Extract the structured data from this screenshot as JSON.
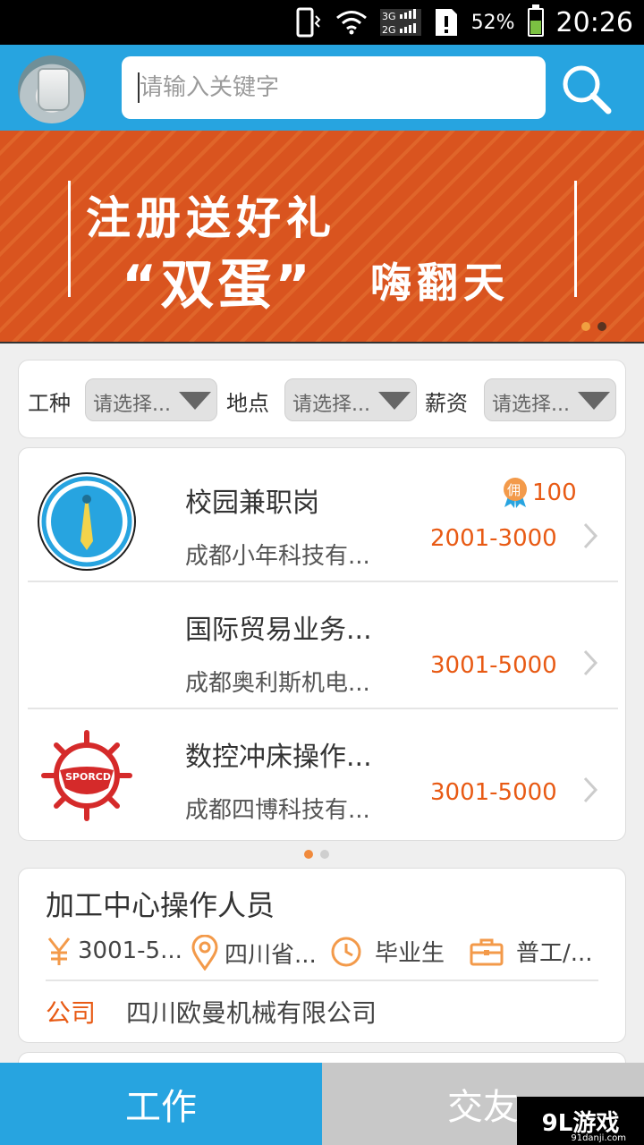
{
  "status_bar": {
    "battery": "52%",
    "time": "20:26",
    "network": "3G 2G"
  },
  "search": {
    "placeholder": "请输入关键字"
  },
  "banner": {
    "line1": "注册送好礼",
    "line2": "“双蛋”",
    "line3": "嗨翻天"
  },
  "filters": [
    {
      "label": "工种",
      "value": "请选择..."
    },
    {
      "label": "地点",
      "value": "请选择..."
    },
    {
      "label": "薪资",
      "value": "请选择..."
    }
  ],
  "jobs": [
    {
      "title": "校园兼职岗",
      "company": "成都小年科技有...",
      "salary": "2001-3000",
      "commission_badge": "佣",
      "commission": "100",
      "logo": "tie-icon"
    },
    {
      "title": "国际贸易业务...",
      "company": "成都奥利斯机电...",
      "salary": "3001-5000",
      "logo": ""
    },
    {
      "title": "数控冲床操作...",
      "company": "成都四博科技有...",
      "salary": "3001-5000",
      "logo": "sporcd-logo",
      "logo_text": "SPORCD"
    }
  ],
  "featured": {
    "title": "加工中心操作人员",
    "salary": "3001-5...",
    "location": "四川省...",
    "experience": "毕业生",
    "category": "普工/...",
    "company_label": "公司",
    "company": "四川欧曼机械有限公司"
  },
  "tabs": {
    "work": "工作",
    "social": "交友"
  },
  "watermark": {
    "brand": "9L游戏",
    "url": "91danji.com"
  },
  "colors": {
    "primary": "#27a4e0",
    "accent": "#e85a14",
    "banner": "#d9541f"
  }
}
